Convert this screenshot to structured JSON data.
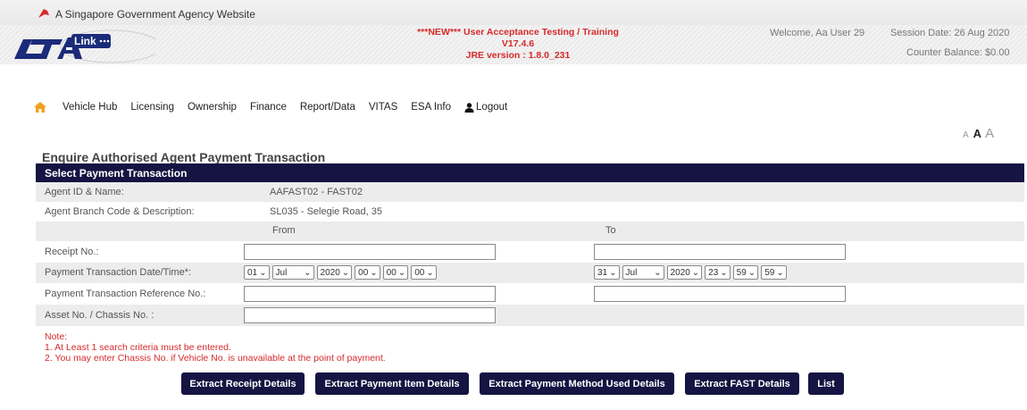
{
  "gov_banner": {
    "text": "A Singapore Government Agency Website"
  },
  "logo": {
    "text": "Link"
  },
  "banner": {
    "line1": "***NEW*** User Acceptance Testing / Training",
    "line2": "V17.4.6",
    "line3": "JRE version : 1.8.0_231"
  },
  "user": {
    "welcome": "Welcome, Aa User 29",
    "session_date": "Session Date: 26 Aug 2020",
    "counter_balance": "Counter Balance: $0.00"
  },
  "nav": {
    "items": [
      "Vehicle Hub",
      "Licensing",
      "Ownership",
      "Finance",
      "Report/Data",
      "VITAS",
      "ESA Info"
    ],
    "logout": "Logout"
  },
  "font_size_controls": {
    "small": "A",
    "medium": "A",
    "large": "A"
  },
  "page": {
    "title": "Enquire Authorised Agent Payment Transaction",
    "panel_title": "Select Payment Transaction"
  },
  "agent": {
    "id_label": "Agent ID & Name:",
    "id_value": "AAFAST02 - FAST02",
    "branch_label": "Agent Branch Code & Description:",
    "branch_value": "SL035 - Selegie Road, 35"
  },
  "columns": {
    "from": "From",
    "to": "To"
  },
  "fields": {
    "receipt_label": "Receipt No.:",
    "date_label": "Payment Transaction Date/Time*:",
    "ref_label": "Payment Transaction Reference No.:",
    "asset_label": "Asset No. / Chassis No. :",
    "receipt_from": "",
    "receipt_to": "",
    "ref_from": "",
    "ref_to": "",
    "asset": ""
  },
  "date_from": {
    "day": "01",
    "month": "Jul",
    "year": "2020",
    "hour": "00",
    "minute": "00",
    "second": "00"
  },
  "date_to": {
    "day": "31",
    "month": "Jul",
    "year": "2020",
    "hour": "23",
    "minute": "59",
    "second": "59"
  },
  "notes": {
    "title": "Note:",
    "line1": "1. At Least 1 search criteria must be entered.",
    "line2": "2. You may enter Chassis No. if Vehicle No. is unavailable at the point of payment."
  },
  "buttons": {
    "extract_receipt": "Extract Receipt Details",
    "extract_item": "Extract Payment Item Details",
    "extract_method": "Extract Payment Method Used Details",
    "extract_fast": "Extract FAST Details",
    "list": "List"
  },
  "colors": {
    "navy": "#151442",
    "red": "#d62a2a",
    "home_icon": "#f0a020"
  }
}
